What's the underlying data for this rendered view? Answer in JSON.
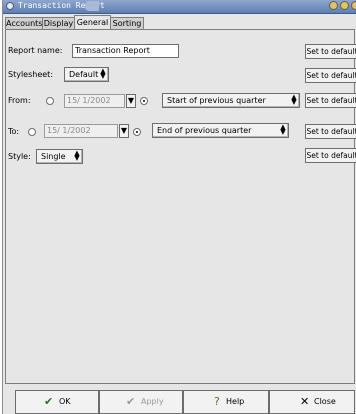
{
  "window": {
    "title": "Transaction Report"
  },
  "tabs": [
    {
      "label": "Accounts"
    },
    {
      "label": "Display"
    },
    {
      "label": "General"
    },
    {
      "label": "Sorting"
    }
  ],
  "general": {
    "report_name": {
      "label": "Report name:",
      "value": "Transaction Report",
      "default_label": "Set to default"
    },
    "stylesheet": {
      "label": "Stylesheet:",
      "value": "Default",
      "default_label": "Set to default"
    },
    "from": {
      "label": "From:",
      "date": "15/ 1/2002",
      "relative": "Start of previous quarter",
      "default_label": "Set to default"
    },
    "to": {
      "label": "To:",
      "date": "15/ 1/2002",
      "relative": "End of previous quarter",
      "default_label": "Set to default"
    },
    "style": {
      "label": "Style:",
      "value": "Single",
      "default_label": "Set to default"
    }
  },
  "buttons": {
    "ok": {
      "label": "OK",
      "icon": "ok-icon"
    },
    "apply": {
      "label": "Apply",
      "icon": "apply-icon"
    },
    "help": {
      "label": "Help",
      "icon": "help-icon"
    },
    "close": {
      "label": "Close",
      "icon": "close-icon"
    }
  }
}
